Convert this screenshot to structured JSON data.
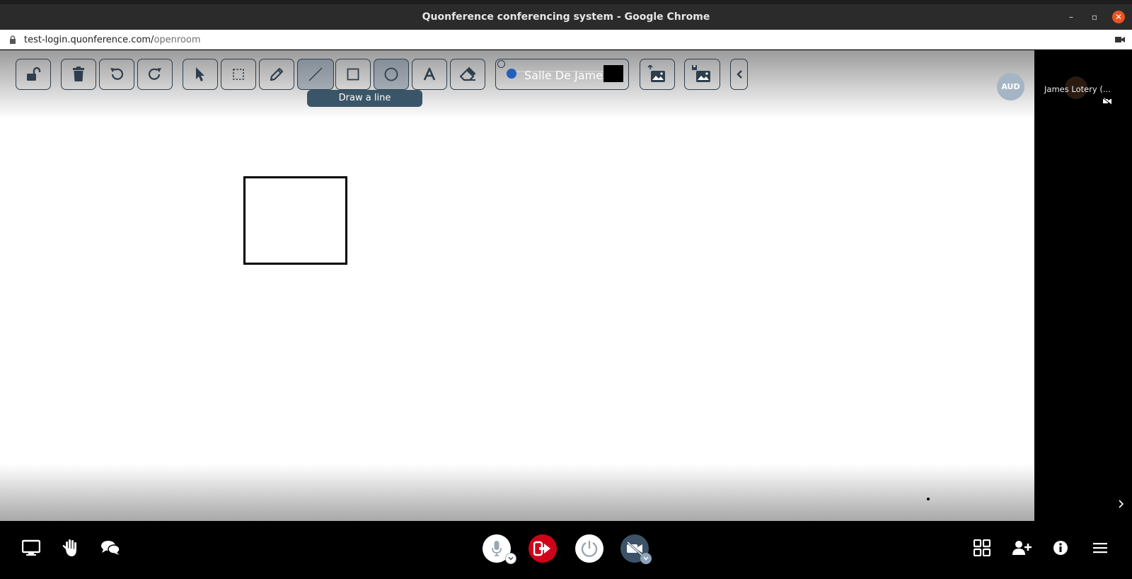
{
  "browser": {
    "window_title": "Quonference conferencing system - Google Chrome",
    "url_host": "test-login.quonference.com/",
    "url_path": "openroom",
    "minimize_symbol": "–",
    "maximize_symbol": "▫",
    "close_symbol": "✕"
  },
  "toolbar": {
    "tools": [
      {
        "name": "unlock-icon"
      },
      {
        "name": "trash-icon"
      },
      {
        "name": "undo-icon"
      },
      {
        "name": "redo-icon"
      },
      {
        "name": "pointer-icon"
      },
      {
        "name": "select-area-icon"
      },
      {
        "name": "pencil-icon"
      },
      {
        "name": "line-icon",
        "active": true
      },
      {
        "name": "square-icon"
      },
      {
        "name": "circle-icon"
      },
      {
        "name": "text-icon"
      },
      {
        "name": "eraser-icon"
      },
      {
        "name": "upload-image-icon"
      },
      {
        "name": "save-image-icon"
      },
      {
        "name": "collapse-chevron-icon"
      }
    ],
    "room_label": "Salle De James",
    "stroke_color": "#000000",
    "tooltip": "Draw a line",
    "tool_border_color": "#2d3e4e"
  },
  "badge": {
    "label": "AUD"
  },
  "participants": [
    {
      "name": "James Lotery (...",
      "camera_off": true
    }
  ],
  "canvas": {
    "shapes": [
      {
        "type": "rectangle",
        "stroke": "#000000"
      }
    ]
  },
  "bottom_bar": {
    "left_icons": [
      "screen-share-icon",
      "raise-hand-icon",
      "chat-icon"
    ],
    "center_buttons": [
      "microphone-button",
      "leave-button",
      "power-button",
      "camera-off-button"
    ],
    "right_icons": [
      "grid-view-icon",
      "add-user-icon",
      "info-icon",
      "menu-icon"
    ],
    "leave_color": "#d0021b",
    "camera_button_color": "#3d5266"
  }
}
